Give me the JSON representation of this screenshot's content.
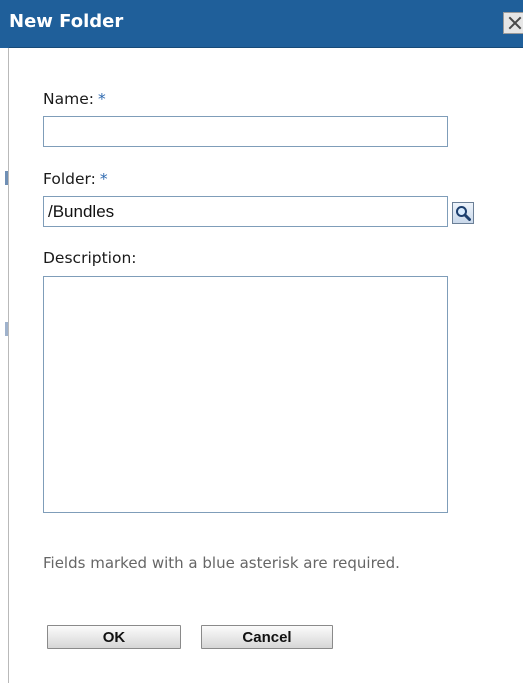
{
  "dialog": {
    "title": "New Folder",
    "close_icon": "close-icon"
  },
  "form": {
    "name": {
      "label": "Name:",
      "required_marker": "*",
      "value": ""
    },
    "folder": {
      "label": "Folder:",
      "required_marker": "*",
      "value": "/Bundles",
      "browse_icon": "magnifier-icon"
    },
    "description": {
      "label": "Description:",
      "value": ""
    }
  },
  "help_text": "Fields marked with a blue asterisk are required.",
  "buttons": {
    "ok_label": "OK",
    "cancel_label": "Cancel"
  },
  "colors": {
    "title_bar": "#1f5f9a",
    "required_asterisk": "#2f6ab0",
    "input_border": "#7f9db9"
  }
}
